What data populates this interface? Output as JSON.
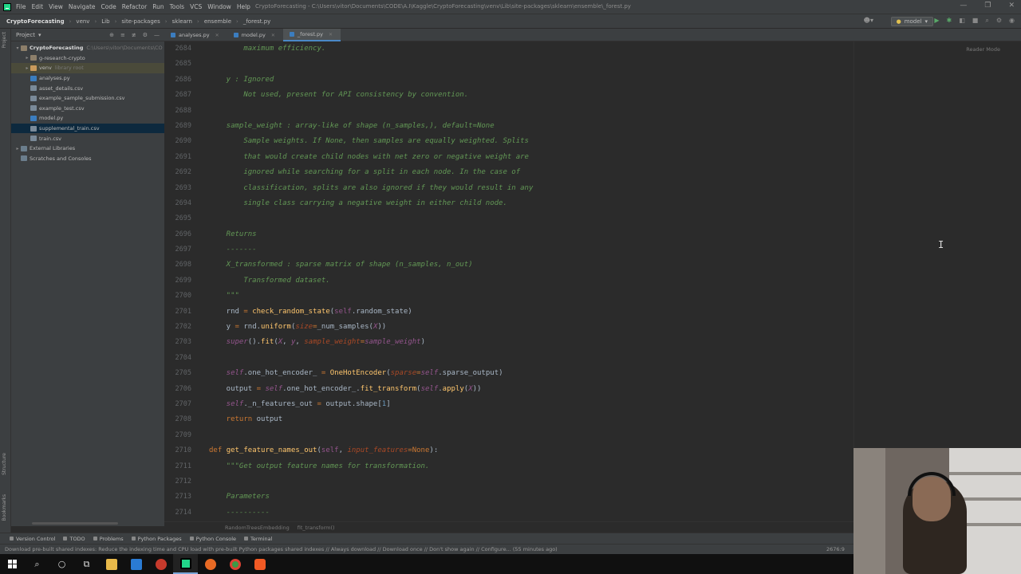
{
  "window": {
    "title": "CryptoForecasting - C:\\Users\\vitor\\Documents\\CODE\\A.I\\Kaggle\\CryptoForecasting\\venv\\Lib\\site-packages\\sklearn\\ensemble\\_forest.py",
    "controls": [
      "—",
      "❐",
      "✕"
    ]
  },
  "menu": [
    "File",
    "Edit",
    "View",
    "Navigate",
    "Code",
    "Refactor",
    "Run",
    "Tools",
    "VCS",
    "Window",
    "Help"
  ],
  "breadcrumb": [
    "CryptoForecasting",
    "venv",
    "Lib",
    "site-packages",
    "sklearn",
    "ensemble",
    "_forest.py"
  ],
  "run_config": "model",
  "project_panel": {
    "title": "Project",
    "tree": [
      {
        "label": "CryptoForecasting",
        "hint": "C:\\Users\\vitor\\Documents\\CO",
        "icon": "folder",
        "depth": 0,
        "arrow": "▾"
      },
      {
        "label": "g-research-crypto",
        "hint": "",
        "icon": "folder",
        "depth": 1,
        "arrow": "▸"
      },
      {
        "label": "venv",
        "hint": "library root",
        "icon": "folder-ex",
        "depth": 1,
        "arrow": "▸"
      },
      {
        "label": "analyses.py",
        "hint": "",
        "icon": "py",
        "depth": 1,
        "arrow": ""
      },
      {
        "label": "asset_details.csv",
        "hint": "",
        "icon": "csv",
        "depth": 1,
        "arrow": ""
      },
      {
        "label": "example_sample_submission.csv",
        "hint": "",
        "icon": "csv",
        "depth": 1,
        "arrow": ""
      },
      {
        "label": "example_test.csv",
        "hint": "",
        "icon": "csv",
        "depth": 1,
        "arrow": ""
      },
      {
        "label": "model.py",
        "hint": "",
        "icon": "py",
        "depth": 1,
        "arrow": ""
      },
      {
        "label": "supplemental_train.csv",
        "hint": "",
        "icon": "csv",
        "depth": 1,
        "arrow": ""
      },
      {
        "label": "train.csv",
        "hint": "",
        "icon": "csv",
        "depth": 1,
        "arrow": ""
      },
      {
        "label": "External Libraries",
        "hint": "",
        "icon": "lib",
        "depth": 0,
        "arrow": "▸"
      },
      {
        "label": "Scratches and Consoles",
        "hint": "",
        "icon": "lib",
        "depth": 0,
        "arrow": ""
      }
    ]
  },
  "tabs": [
    {
      "label": "analyses.py",
      "active": false
    },
    {
      "label": "model.py",
      "active": false
    },
    {
      "label": "_forest.py",
      "active": true
    }
  ],
  "editor": {
    "reader_mode": "Reader Mode",
    "line_numbers": [
      "2684",
      "2685",
      "2686",
      "2687",
      "2688",
      "2689",
      "2690",
      "2691",
      "2692",
      "2693",
      "2694",
      "2695",
      "2696",
      "2697",
      "2698",
      "2699",
      "2700",
      "2701",
      "2702",
      "2703",
      "2704",
      "2705",
      "2706",
      "2707",
      "2708",
      "2709",
      "2710",
      "2711",
      "2712",
      "2713",
      "2714"
    ],
    "lines": [
      [
        {
          "c": "doc",
          "t": "        maximum efficiency."
        }
      ],
      [],
      [
        {
          "c": "doc",
          "t": "    y : Ignored"
        }
      ],
      [
        {
          "c": "doc",
          "t": "        Not used, present for API consistency by convention."
        }
      ],
      [],
      [
        {
          "c": "doc",
          "t": "    sample_weight : array-like of shape (n_samples,), default=None"
        }
      ],
      [
        {
          "c": "doc",
          "t": "        Sample weights. If None, then samples are equally weighted. Splits"
        }
      ],
      [
        {
          "c": "doc",
          "t": "        that would create child nodes with net zero or negative weight are"
        }
      ],
      [
        {
          "c": "doc",
          "t": "        ignored while searching for a split in each node. In the case of"
        }
      ],
      [
        {
          "c": "doc",
          "t": "        classification, splits are also ignored if they would result in any"
        }
      ],
      [
        {
          "c": "doc",
          "t": "        single class carrying a negative weight in either child node."
        }
      ],
      [],
      [
        {
          "c": "doc",
          "t": "    Returns"
        }
      ],
      [
        {
          "c": "doc",
          "t": "    -------"
        }
      ],
      [
        {
          "c": "doc",
          "t": "    X_transformed : sparse matrix of shape (n_samples, n_out)"
        }
      ],
      [
        {
          "c": "doc",
          "t": "        Transformed dataset."
        }
      ],
      [
        {
          "c": "doc",
          "t": "    \"\"\""
        }
      ],
      [
        {
          "c": "t",
          "t": "    rnd "
        },
        {
          "c": "k",
          "t": "= "
        },
        {
          "c": "f",
          "t": "check_random_state"
        },
        {
          "c": "t",
          "t": "("
        },
        {
          "c": "p",
          "t": "self"
        },
        {
          "c": "t",
          "t": ".random_state)"
        }
      ],
      [
        {
          "c": "t",
          "t": "    y "
        },
        {
          "c": "k",
          "t": "= "
        },
        {
          "c": "t",
          "t": "rnd."
        },
        {
          "c": "f",
          "t": "uniform"
        },
        {
          "c": "t",
          "t": "("
        },
        {
          "c": "kw",
          "t": "size"
        },
        {
          "c": "k",
          "t": "="
        },
        {
          "c": "t",
          "t": "_num_samples("
        },
        {
          "c": "sf",
          "t": "X"
        },
        {
          "c": "t",
          "t": "))"
        }
      ],
      [
        {
          "c": "sf",
          "t": "    super"
        },
        {
          "c": "t",
          "t": "()."
        },
        {
          "c": "f",
          "t": "fit"
        },
        {
          "c": "t",
          "t": "("
        },
        {
          "c": "sf",
          "t": "X"
        },
        {
          "c": "t",
          "t": ", "
        },
        {
          "c": "sf",
          "t": "y"
        },
        {
          "c": "t",
          "t": ", "
        },
        {
          "c": "kw",
          "t": "sample_weight"
        },
        {
          "c": "k",
          "t": "="
        },
        {
          "c": "sf",
          "t": "sample_weight"
        },
        {
          "c": "t",
          "t": ")"
        }
      ],
      [],
      [
        {
          "c": "sf",
          "t": "    self"
        },
        {
          "c": "t",
          "t": ".one_hot_encoder_ "
        },
        {
          "c": "k",
          "t": "= "
        },
        {
          "c": "f",
          "t": "OneHotEncoder"
        },
        {
          "c": "t",
          "t": "("
        },
        {
          "c": "kw",
          "t": "sparse"
        },
        {
          "c": "k",
          "t": "="
        },
        {
          "c": "sf",
          "t": "self"
        },
        {
          "c": "t",
          "t": ".sparse_output)"
        }
      ],
      [
        {
          "c": "t",
          "t": "    output "
        },
        {
          "c": "k",
          "t": "= "
        },
        {
          "c": "sf",
          "t": "self"
        },
        {
          "c": "t",
          "t": ".one_hot_encoder_."
        },
        {
          "c": "f",
          "t": "fit_transform"
        },
        {
          "c": "t",
          "t": "("
        },
        {
          "c": "sf",
          "t": "self"
        },
        {
          "c": "t",
          "t": "."
        },
        {
          "c": "f",
          "t": "apply"
        },
        {
          "c": "t",
          "t": "("
        },
        {
          "c": "sf",
          "t": "X"
        },
        {
          "c": "t",
          "t": "))"
        }
      ],
      [
        {
          "c": "sf",
          "t": "    self"
        },
        {
          "c": "t",
          "t": "._n_features_out "
        },
        {
          "c": "k",
          "t": "= "
        },
        {
          "c": "t",
          "t": "output.shape["
        },
        {
          "c": "n",
          "t": "1"
        },
        {
          "c": "t",
          "t": "]"
        }
      ],
      [
        {
          "c": "k",
          "t": "    return "
        },
        {
          "c": "t",
          "t": "output"
        }
      ],
      [],
      [
        {
          "c": "k",
          "t": "def "
        },
        {
          "c": "f",
          "t": "get_feature_names_out"
        },
        {
          "c": "t",
          "t": "("
        },
        {
          "c": "p",
          "t": "self"
        },
        {
          "c": "t",
          "t": ", "
        },
        {
          "c": "kw",
          "t": "input_features"
        },
        {
          "c": "k",
          "t": "="
        },
        {
          "c": "k",
          "t": "None"
        },
        {
          "c": "t",
          "t": "):"
        }
      ],
      [
        {
          "c": "doc",
          "t": "    \"\"\"Get output feature names for transformation."
        }
      ],
      [],
      [
        {
          "c": "doc",
          "t": "    Parameters"
        }
      ],
      [
        {
          "c": "doc",
          "t": "    ----------"
        }
      ]
    ]
  },
  "code_breadcrumb": [
    "RandomTreesEmbedding",
    "fit_transform()"
  ],
  "bottom_tools": [
    "Version Control",
    "TODO",
    "Problems",
    "Python Packages",
    "Python Console",
    "Terminal"
  ],
  "status": {
    "message": "Download pre-built shared indexes: Reduce the indexing time and CPU load with pre-built Python packages shared indexes // Always download // Download once // Don't show again // Configure... (55 minutes ago)",
    "position": "2676:9"
  },
  "left_stripe": {
    "project": "Project",
    "structure": "Structure",
    "bookmarks": "Bookmarks"
  },
  "taskbar": [
    "start",
    "search",
    "cortana",
    "task-view",
    "file-explorer",
    "vscode",
    "app-red",
    "pycharm",
    "firefox",
    "chrome",
    "brave"
  ]
}
